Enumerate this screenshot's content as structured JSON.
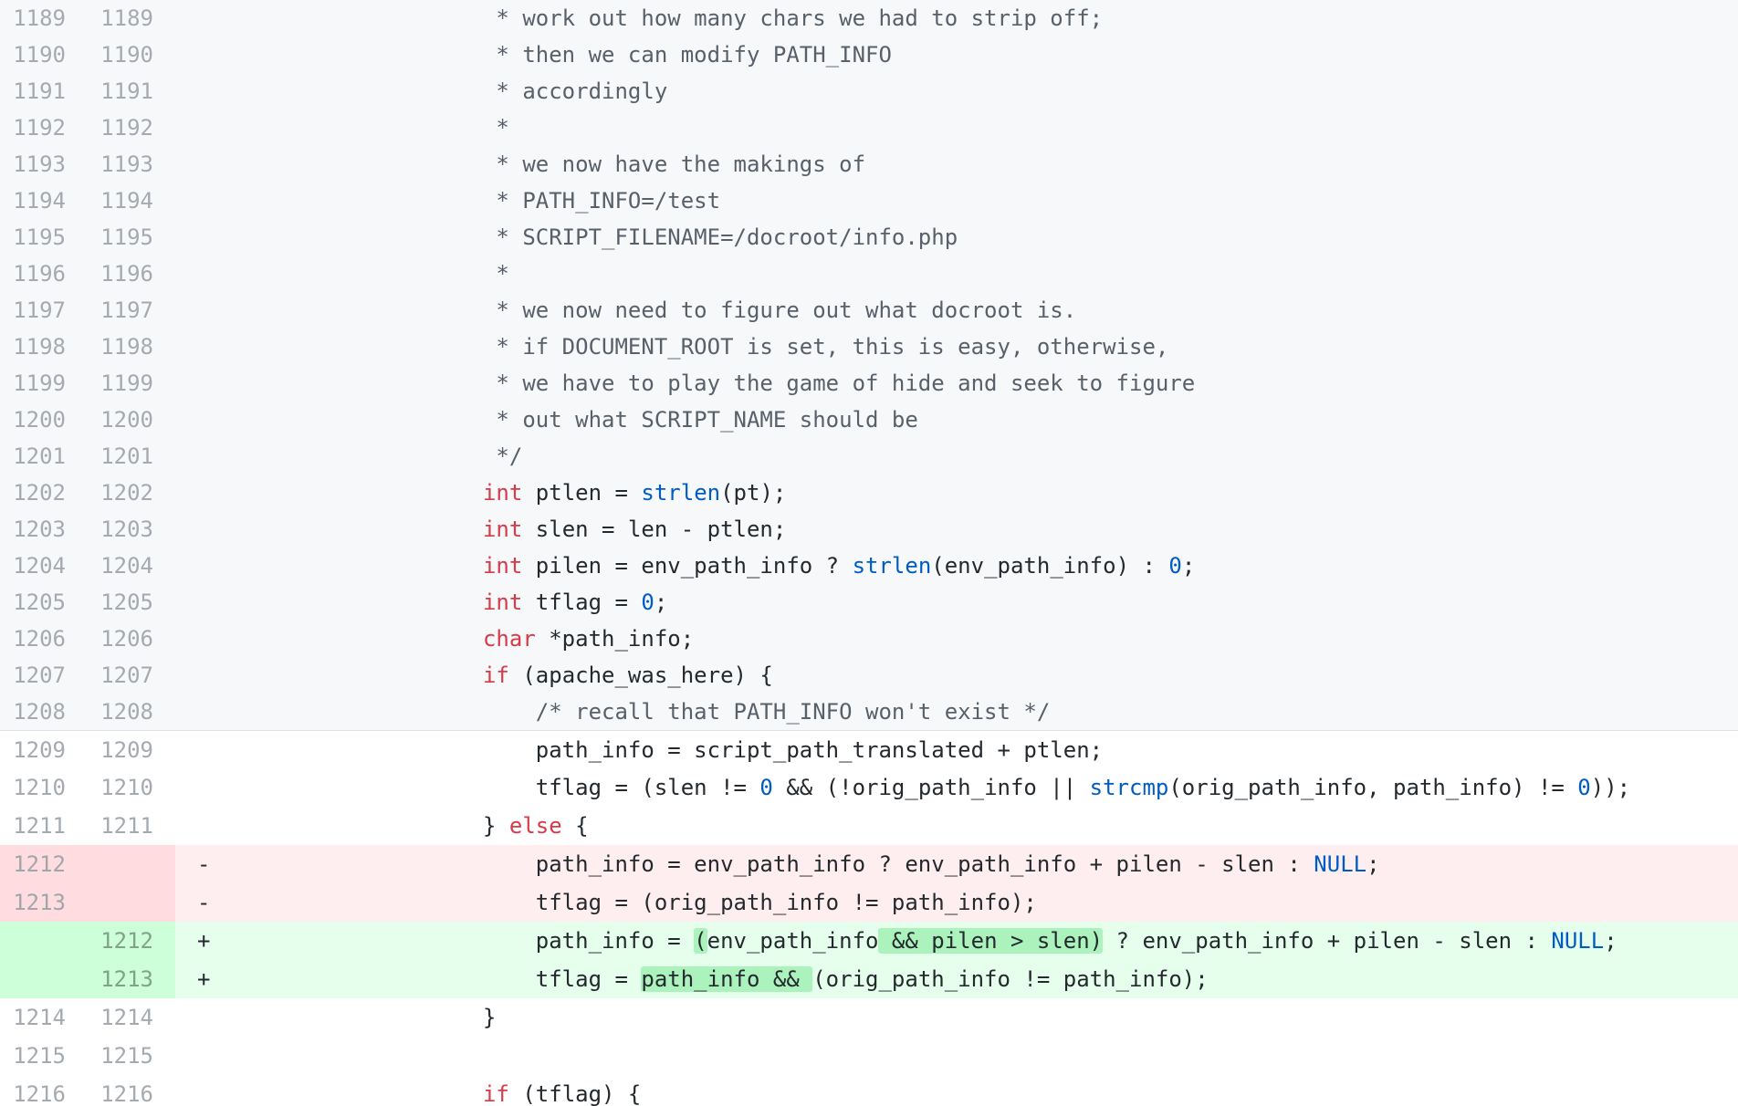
{
  "diff": {
    "lines": [
      {
        "type": "ctx-exp",
        "old": "1189",
        "new": "1189",
        "marker": "",
        "tokens": [
          [
            "cm",
            "                     * work out how many chars we had to strip off;"
          ]
        ]
      },
      {
        "type": "ctx-exp",
        "old": "1190",
        "new": "1190",
        "marker": "",
        "tokens": [
          [
            "cm",
            "                     * then we can modify PATH_INFO"
          ]
        ]
      },
      {
        "type": "ctx-exp",
        "old": "1191",
        "new": "1191",
        "marker": "",
        "tokens": [
          [
            "cm",
            "                     * accordingly"
          ]
        ]
      },
      {
        "type": "ctx-exp",
        "old": "1192",
        "new": "1192",
        "marker": "",
        "tokens": [
          [
            "cm",
            "                     *"
          ]
        ]
      },
      {
        "type": "ctx-exp",
        "old": "1193",
        "new": "1193",
        "marker": "",
        "tokens": [
          [
            "cm",
            "                     * we now have the makings of"
          ]
        ]
      },
      {
        "type": "ctx-exp",
        "old": "1194",
        "new": "1194",
        "marker": "",
        "tokens": [
          [
            "cm",
            "                     * PATH_INFO=/test"
          ]
        ]
      },
      {
        "type": "ctx-exp",
        "old": "1195",
        "new": "1195",
        "marker": "",
        "tokens": [
          [
            "cm",
            "                     * SCRIPT_FILENAME=/docroot/info.php"
          ]
        ]
      },
      {
        "type": "ctx-exp",
        "old": "1196",
        "new": "1196",
        "marker": "",
        "tokens": [
          [
            "cm",
            "                     *"
          ]
        ]
      },
      {
        "type": "ctx-exp",
        "old": "1197",
        "new": "1197",
        "marker": "",
        "tokens": [
          [
            "cm",
            "                     * we now need to figure out what docroot is."
          ]
        ]
      },
      {
        "type": "ctx-exp",
        "old": "1198",
        "new": "1198",
        "marker": "",
        "tokens": [
          [
            "cm",
            "                     * if DOCUMENT_ROOT is set, this is easy, otherwise,"
          ]
        ]
      },
      {
        "type": "ctx-exp",
        "old": "1199",
        "new": "1199",
        "marker": "",
        "tokens": [
          [
            "cm",
            "                     * we have to play the game of hide and seek to figure"
          ]
        ]
      },
      {
        "type": "ctx-exp",
        "old": "1200",
        "new": "1200",
        "marker": "",
        "tokens": [
          [
            "cm",
            "                     * out what SCRIPT_NAME should be"
          ]
        ]
      },
      {
        "type": "ctx-exp",
        "old": "1201",
        "new": "1201",
        "marker": "",
        "tokens": [
          [
            "cm",
            "                     */"
          ]
        ]
      },
      {
        "type": "ctx-exp",
        "old": "1202",
        "new": "1202",
        "marker": "",
        "tokens": [
          [
            "",
            "                    "
          ],
          [
            "kw",
            "int"
          ],
          [
            "",
            " ptlen = "
          ],
          [
            "fn",
            "strlen"
          ],
          [
            "",
            "(pt);"
          ]
        ]
      },
      {
        "type": "ctx-exp",
        "old": "1203",
        "new": "1203",
        "marker": "",
        "tokens": [
          [
            "",
            "                    "
          ],
          [
            "kw",
            "int"
          ],
          [
            "",
            " slen = len - ptlen;"
          ]
        ]
      },
      {
        "type": "ctx-exp",
        "old": "1204",
        "new": "1204",
        "marker": "",
        "tokens": [
          [
            "",
            "                    "
          ],
          [
            "kw",
            "int"
          ],
          [
            "",
            " pilen = env_path_info ? "
          ],
          [
            "fn",
            "strlen"
          ],
          [
            "",
            "(env_path_info) : "
          ],
          [
            "nu",
            "0"
          ],
          [
            "",
            ";"
          ]
        ]
      },
      {
        "type": "ctx-exp",
        "old": "1205",
        "new": "1205",
        "marker": "",
        "tokens": [
          [
            "",
            "                    "
          ],
          [
            "kw",
            "int"
          ],
          [
            "",
            " tflag = "
          ],
          [
            "nu",
            "0"
          ],
          [
            "",
            ";"
          ]
        ]
      },
      {
        "type": "ctx-exp",
        "old": "1206",
        "new": "1206",
        "marker": "",
        "tokens": [
          [
            "",
            "                    "
          ],
          [
            "kw",
            "char"
          ],
          [
            "",
            " *path_info;"
          ]
        ]
      },
      {
        "type": "ctx-exp",
        "old": "1207",
        "new": "1207",
        "marker": "",
        "tokens": [
          [
            "",
            "                    "
          ],
          [
            "kw",
            "if"
          ],
          [
            "",
            " (apache_was_here) {"
          ]
        ]
      },
      {
        "type": "ctx-exp",
        "old": "1208",
        "new": "1208",
        "marker": "",
        "tokens": [
          [
            "cm",
            "                        /* recall that PATH_INFO won't exist */"
          ]
        ]
      },
      {
        "type": "ctx",
        "old": "1209",
        "new": "1209",
        "marker": "",
        "tokens": [
          [
            "",
            "                        path_info = script_path_translated + ptlen;"
          ]
        ]
      },
      {
        "type": "ctx",
        "old": "1210",
        "new": "1210",
        "marker": "",
        "tokens": [
          [
            "",
            "                        tflag = (slen != "
          ],
          [
            "nu",
            "0"
          ],
          [
            "",
            " && (!orig_path_info || "
          ],
          [
            "fn",
            "strcmp"
          ],
          [
            "",
            "(orig_path_info, path_info) != "
          ],
          [
            "nu",
            "0"
          ],
          [
            "",
            "));"
          ]
        ]
      },
      {
        "type": "ctx",
        "old": "1211",
        "new": "1211",
        "marker": "",
        "tokens": [
          [
            "",
            "                    } "
          ],
          [
            "kw",
            "else"
          ],
          [
            "",
            " {"
          ]
        ]
      },
      {
        "type": "del",
        "old": "1212",
        "new": "",
        "marker": "-",
        "tokens": [
          [
            "",
            "                        path_info = env_path_info ? env_path_info + pilen - slen : "
          ],
          [
            "nu",
            "NULL"
          ],
          [
            "",
            ";"
          ]
        ]
      },
      {
        "type": "del",
        "old": "1213",
        "new": "",
        "marker": "-",
        "tokens": [
          [
            "",
            "                        tflag = (orig_path_info != path_info);"
          ]
        ]
      },
      {
        "type": "add",
        "old": "",
        "new": "1212",
        "marker": "+",
        "tokens": [
          [
            "",
            "                        path_info = "
          ],
          [
            "hl",
            "("
          ],
          [
            "",
            "env_path_info"
          ],
          [
            "hl",
            " && pilen > slen)"
          ],
          [
            "",
            " ? env_path_info + pilen - slen : "
          ],
          [
            "nu",
            "NULL"
          ],
          [
            "",
            ";"
          ]
        ]
      },
      {
        "type": "add",
        "old": "",
        "new": "1213",
        "marker": "+",
        "tokens": [
          [
            "",
            "                        tflag = "
          ],
          [
            "hl",
            "path_info && "
          ],
          [
            "",
            "(orig_path_info != path_info);"
          ]
        ]
      },
      {
        "type": "ctx",
        "old": "1214",
        "new": "1214",
        "marker": "",
        "tokens": [
          [
            "",
            "                    }"
          ]
        ]
      },
      {
        "type": "ctx",
        "old": "1215",
        "new": "1215",
        "marker": "",
        "tokens": [
          [
            "",
            ""
          ]
        ]
      },
      {
        "type": "ctx",
        "old": "1216",
        "new": "1216",
        "marker": "",
        "tokens": [
          [
            "",
            "                    "
          ],
          [
            "kw",
            "if"
          ],
          [
            "",
            " (tflag) {"
          ]
        ]
      }
    ]
  }
}
